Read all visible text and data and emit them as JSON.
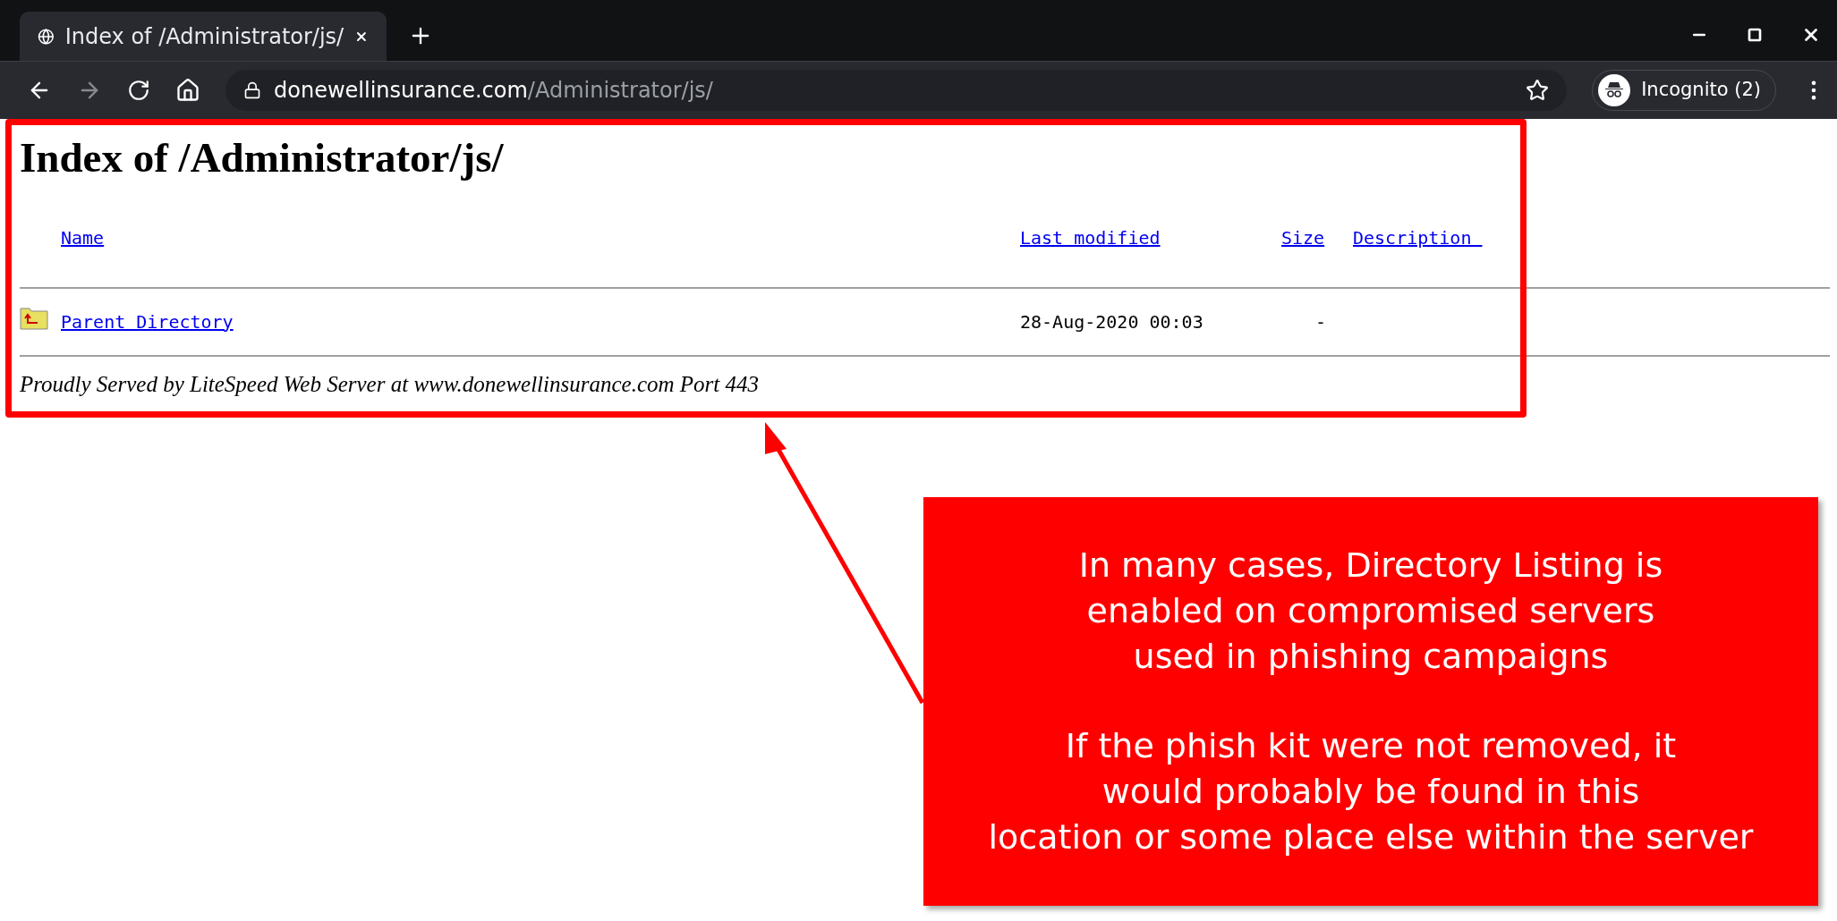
{
  "browser": {
    "tab_title": "Index of /Administrator/js/",
    "url_host": "donewellinsurance.com",
    "url_path": "/Administrator/js/",
    "profile": "Incognito (2)"
  },
  "page": {
    "heading": "Index of /Administrator/js/",
    "columns": [
      {
        "label": "Name"
      },
      {
        "label": "Last modified"
      },
      {
        "label": "Size"
      },
      {
        "label": "Description "
      }
    ],
    "rows": [
      {
        "name": "Parent Directory",
        "modified": "28-Aug-2020 00:03",
        "size": "-"
      }
    ],
    "footer": "Proudly Served by LiteSpeed Web Server at www.donewellinsurance.com Port 443"
  },
  "annotation": {
    "paragraphs": [
      "In many cases, Directory Listing is\nenabled on compromised servers\nused in phishing campaigns",
      "If the phish kit were not removed, it\nwould probably be found in this\nlocation or some place else within the server"
    ]
  }
}
